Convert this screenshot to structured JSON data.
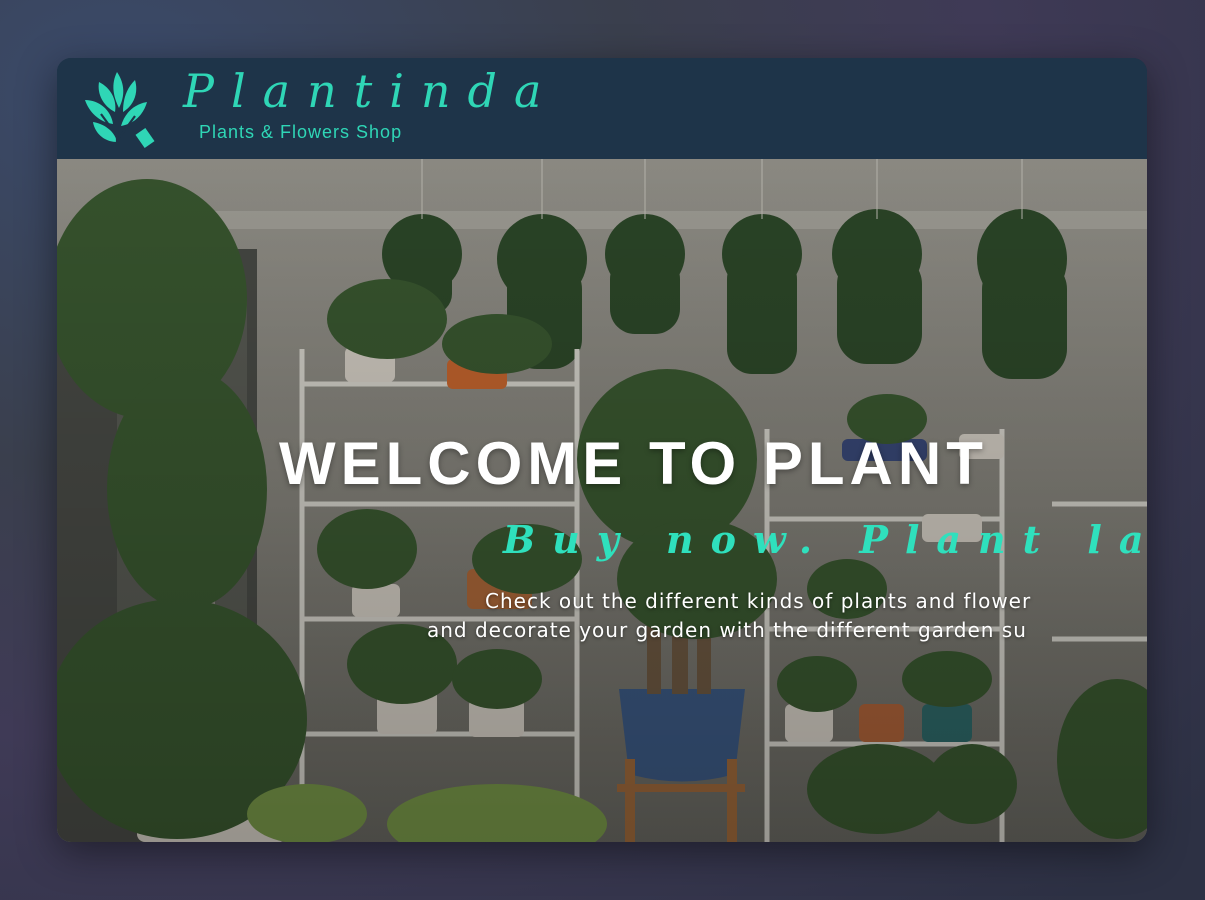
{
  "header": {
    "brand": "Plantinda",
    "tagline": "Plants & Flowers Shop",
    "logo_icon": "leaf-tag-icon",
    "colors": {
      "header_bg": "#1e3449",
      "accent": "#2fd6b6"
    }
  },
  "hero": {
    "title": "WELCOME TO PLANT",
    "subtitle": "Buy now. Plant later",
    "text_line_1": "Check out the different kinds of plants and flower",
    "text_line_2": "and decorate your garden with the different garden su",
    "background": "plant-shop-interior-photo"
  }
}
